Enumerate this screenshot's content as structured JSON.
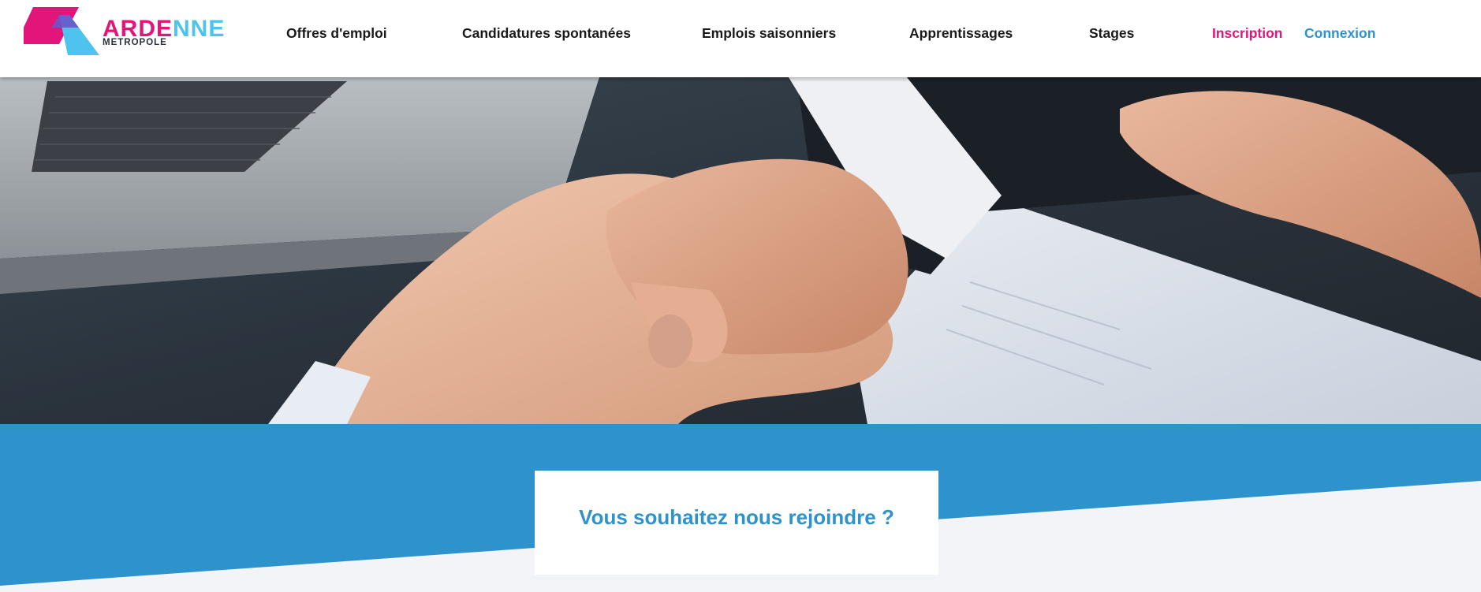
{
  "brand": {
    "name_main": "ARDENNE",
    "name_sub": "METROPOLE",
    "colors": {
      "pink": "#e2157a",
      "cyan": "#4dc3ee",
      "dark": "#2b2f3a"
    }
  },
  "nav": {
    "items": [
      {
        "label": "Offres d'emploi"
      },
      {
        "label": "Candidatures spontanées"
      },
      {
        "label": "Emplois saisonniers"
      },
      {
        "label": "Apprentissages"
      },
      {
        "label": "Stages"
      }
    ],
    "signup": "Inscription",
    "login": "Connexion"
  },
  "hero": {
    "image": "handshake-photo"
  },
  "cta": {
    "title": "Vous souhaitez nous rejoindre ?"
  },
  "colors": {
    "accent_blue": "#2e92cd",
    "accent_pink": "#e2157a",
    "background": "#f2f4f8"
  }
}
